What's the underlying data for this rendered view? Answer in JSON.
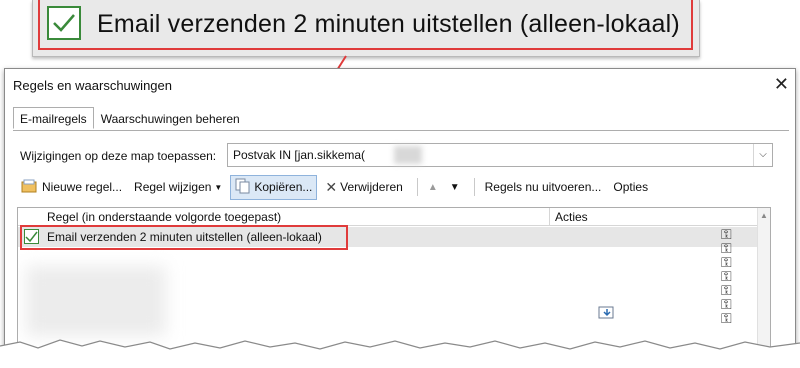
{
  "zoom": {
    "rule_label": "Email verzenden 2 minuten uitstellen  (alleen-lokaal)",
    "checked": true
  },
  "dialog": {
    "title": "Regels en waarschuwingen",
    "close_icon": "close-icon",
    "tabs": [
      {
        "label": "E-mailregels",
        "active": true
      },
      {
        "label": "Waarschuwingen beheren",
        "active": false
      }
    ],
    "folder": {
      "label": "Wijzigingen op deze map toepassen:",
      "value": "Postvak IN [jan.sikkema("
    },
    "toolbar": {
      "new_rule": "Nieuwe regel...",
      "edit_rule": "Regel wijzigen",
      "copy": "Kopiëren...",
      "delete": "Verwijderen",
      "run_rules": "Regels nu uitvoeren...",
      "options": "Opties"
    },
    "table": {
      "columns": [
        "Regel (in onderstaande volgorde toegepast)",
        "Acties"
      ],
      "rows": [
        {
          "label": "Email verzenden 2 minuten uitstellen  (alleen-lokaal)",
          "checked": true
        }
      ]
    }
  },
  "colors": {
    "highlight": "#e03b3b",
    "check": "#3a8a3a",
    "selected_row": "#e6e6e6"
  }
}
